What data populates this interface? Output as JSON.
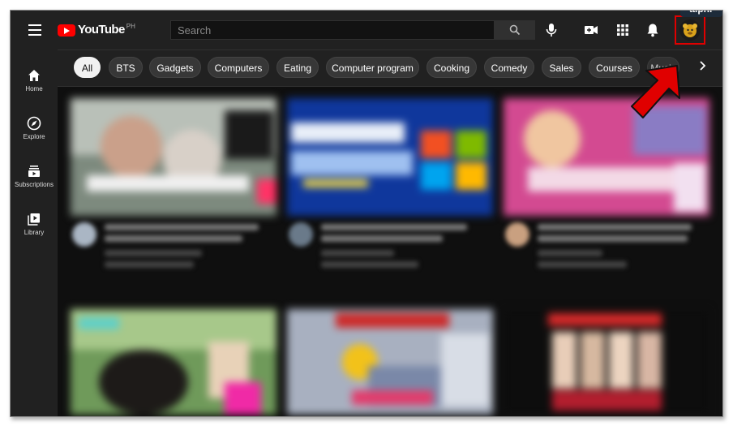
{
  "watermark": "alphr",
  "header": {
    "logo_text": "YouTube",
    "region": "PH",
    "search_placeholder": "Search"
  },
  "sidebar": {
    "items": [
      {
        "label": "Home"
      },
      {
        "label": "Explore"
      },
      {
        "label": "Subscriptions"
      },
      {
        "label": "Library"
      }
    ]
  },
  "chips": [
    "All",
    "BTS",
    "Gadgets",
    "Computers",
    "Eating",
    "Computer program",
    "Cooking",
    "Comedy",
    "Sales",
    "Courses",
    "Music"
  ],
  "colors": {
    "brand": "#ff0000",
    "highlight": "#e00000",
    "background": "#0f0f0f",
    "header": "#212121"
  },
  "icons": [
    "menu-icon",
    "search-icon",
    "mic-icon",
    "create-video-icon",
    "apps-icon",
    "bell-icon",
    "avatar-icon",
    "home-icon",
    "explore-icon",
    "subscriptions-icon",
    "library-icon",
    "chevron-right-icon",
    "red-arrow-icon"
  ]
}
